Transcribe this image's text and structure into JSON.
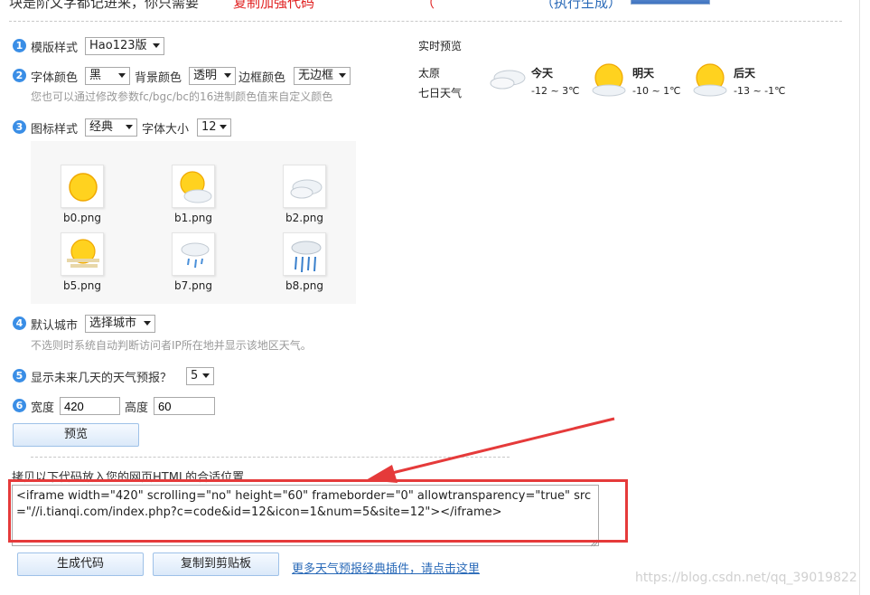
{
  "top_fragment": {
    "left_text": "块是阶文字都记进来，你只需要",
    "red_text": "复制加强代码",
    "red_text2": "（",
    "blue_text": "（执行生成）"
  },
  "step1": {
    "number": "1",
    "label": "模版样式",
    "template_value": "Hao123版"
  },
  "step2": {
    "number": "2",
    "font_color_label": "字体颜色",
    "font_color_value": "黑",
    "bg_color_label": "背景颜色",
    "bg_color_value": "透明",
    "border_color_label": "边框颜色",
    "border_color_value": "无边框",
    "hint": "您也可以通过修改参数fc/bgc/bc的16进制颜色值来自定义颜色"
  },
  "step3": {
    "number": "3",
    "icon_style_label": "图标样式",
    "icon_style_value": "经典",
    "font_size_label": "字体大小",
    "font_size_value": "12",
    "icons": [
      {
        "name": "b0.png",
        "icon": "sun-icon"
      },
      {
        "name": "b1.png",
        "icon": "sun-cloud-icon"
      },
      {
        "name": "b2.png",
        "icon": "cloud-icon"
      },
      {
        "name": "b5.png",
        "icon": "sun-haze-icon"
      },
      {
        "name": "b7.png",
        "icon": "light-rain-icon"
      },
      {
        "name": "b8.png",
        "icon": "heavy-rain-icon"
      }
    ]
  },
  "step4": {
    "number": "4",
    "label": "默认城市",
    "city_value": "选择城市",
    "hint": "不选则时系统自动判断访问者IP所在地并显示该地区天气。"
  },
  "step5": {
    "number": "5",
    "label": "显示未来几天的天气预报？",
    "days_value": "5"
  },
  "step6": {
    "number": "6",
    "width_label": "宽度",
    "width_value": "420",
    "height_label": "高度",
    "height_value": "60"
  },
  "preview_button": "预览",
  "preview": {
    "title": "实时预览",
    "city": "太原",
    "seven_day": "七日天气",
    "days": [
      {
        "name": "今天",
        "temp": "-12 ~ 3℃",
        "icon": "cloud-icon"
      },
      {
        "name": "明天",
        "temp": "-10 ~ 1℃",
        "icon": "sun-cloud-icon"
      },
      {
        "name": "后天",
        "temp": "-13 ~ -1℃",
        "icon": "sun-cloud-icon"
      }
    ]
  },
  "code_section": {
    "instruction": "拷贝以下代码放入您的网页HTML的合适位置",
    "code": "<iframe width=\"420\" scrolling=\"no\" height=\"60\" frameborder=\"0\" allowtransparency=\"true\" src=\"//i.tianqi.com/index.php?c=code&id=12&icon=1&num=5&site=12\"></iframe>"
  },
  "buttons": {
    "generate": "生成代码",
    "copy": "复制到剪贴板"
  },
  "more_link": "更多天气预报经典插件，请点击这里",
  "watermark": "https://blog.csdn.net/qq_39019822",
  "colors": {
    "accent_blue": "#3a8ee6",
    "annotation_red": "#e53a3a",
    "link_blue": "#2a6ab8"
  }
}
